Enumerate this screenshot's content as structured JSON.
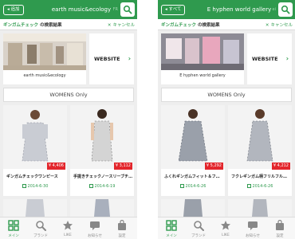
{
  "colors": {
    "accent": "#2f9a4e",
    "price_badge": "#e3262c",
    "background": "#eeeeee"
  },
  "screens": [
    {
      "header": {
        "back_label": "◂ 追加",
        "title": "earth music&ecology",
        "faded_text": "FR",
        "search_icon": "search-icon"
      },
      "subbar": {
        "brand_check": "ギンガムチェック",
        "result_label": "の検索結果",
        "cancel_label": "キャンセル"
      },
      "brand": {
        "name": "earth music&ecology",
        "website_label": "WEBSITE"
      },
      "womens_label": "WOMENS Only",
      "products": [
        {
          "name": "ギンガムチェックワンピース",
          "price": "¥ 4,406",
          "date": "2014-6-30"
        },
        {
          "name": "手提きチェックノースリーブチ…",
          "price": "¥ 3,112",
          "date": "2014-6-19"
        }
      ]
    },
    {
      "header": {
        "back_label": "◂ すべて",
        "title": "E hyphen world gallery",
        "faded_text": "ei",
        "search_icon": "search-icon"
      },
      "subbar": {
        "brand_check": "ギンガムチェック",
        "result_label": "の検索結果",
        "cancel_label": "キャンセル"
      },
      "brand": {
        "name": "E hyphen world gallery",
        "website_label": "WEBSITE"
      },
      "womens_label": "WOMENS Only",
      "products": [
        {
          "name": "ふくれギンガムフィット＆フ…",
          "price": "¥ 5,292",
          "date": "2014-6-26"
        },
        {
          "name": "フクレギンガム柄フリルフル…",
          "price": "¥ 4,212",
          "date": "2014-6-26"
        }
      ]
    }
  ],
  "tabs": [
    {
      "label": "メイン",
      "icon": "grid-icon"
    },
    {
      "label": "ブランド",
      "icon": "search-icon"
    },
    {
      "label": "LIKE",
      "icon": "star-icon"
    },
    {
      "label": "お知らせ",
      "icon": "chat-icon"
    },
    {
      "label": "設定",
      "icon": "bag-icon"
    }
  ]
}
